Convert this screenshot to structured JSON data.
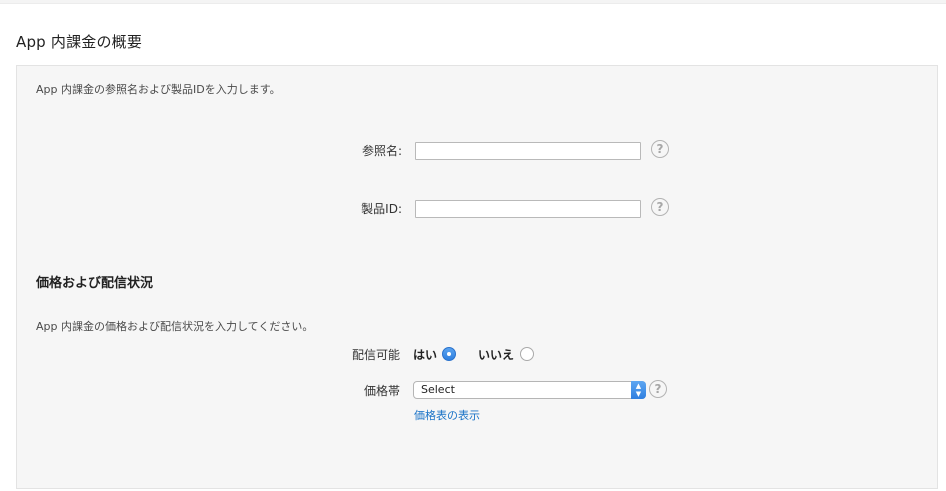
{
  "overview": {
    "title": "App 内課金の概要",
    "intro": "App 内課金の参照名および製品IDを入力します。"
  },
  "form": {
    "reference_name": {
      "label": "参照名:",
      "value": "",
      "placeholder": ""
    },
    "product_id": {
      "label": "製品ID:",
      "value": "",
      "placeholder": ""
    },
    "help_glyph": "?"
  },
  "pricing": {
    "title": "価格および配信状況",
    "intro": "App 内課金の価格および配信状況を入力してください。",
    "availability": {
      "label": "配信可能",
      "yes_label": "はい",
      "no_label": "いいえ",
      "selected": "yes"
    },
    "price_tier": {
      "label": "価格帯",
      "selected": "Select"
    },
    "price_matrix_link": "価格表の表示"
  },
  "colors": {
    "accent": "#2f7fe0",
    "link": "#1a73c7",
    "panel_bg": "#f6f6f6"
  },
  "icons": {
    "help": "question-circle-icon",
    "select_arrow": "chevron-up-down-icon"
  }
}
